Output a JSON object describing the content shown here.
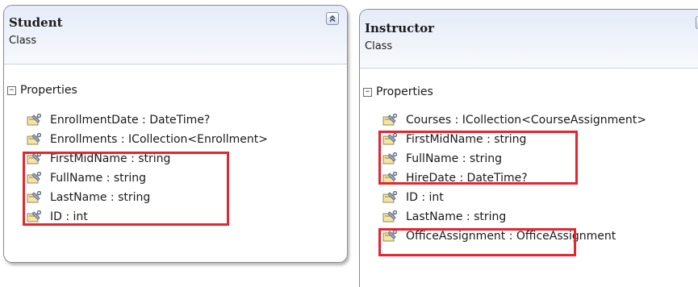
{
  "diagram": {
    "classes": [
      {
        "id": "student",
        "title": "Student",
        "subtitle": "Class",
        "collapse_icon": "double-chevron-up-icon",
        "section": {
          "label": "Properties",
          "toggle": "⊟"
        },
        "properties": [
          "EnrollmentDate : DateTime?",
          "Enrollments : ICollection<Enrollment>",
          "FirstMidName : string",
          "FullName : string",
          "LastName : string",
          "ID : int"
        ]
      },
      {
        "id": "instructor",
        "title": "Instructor",
        "subtitle": "Class",
        "collapse_icon": "double-chevron-up-icon",
        "section": {
          "label": "Properties",
          "toggle": "⊟"
        },
        "properties": [
          "Courses : ICollection<CourseAssignment>",
          "FirstMidName : string",
          "FullName : string",
          "HireDate : DateTime?",
          "ID : int",
          "LastName : string",
          "OfficeAssignment : OfficeAssignment"
        ]
      }
    ],
    "highlight_color": "#e3262f",
    "property_icon": "property-wrench-icon"
  }
}
